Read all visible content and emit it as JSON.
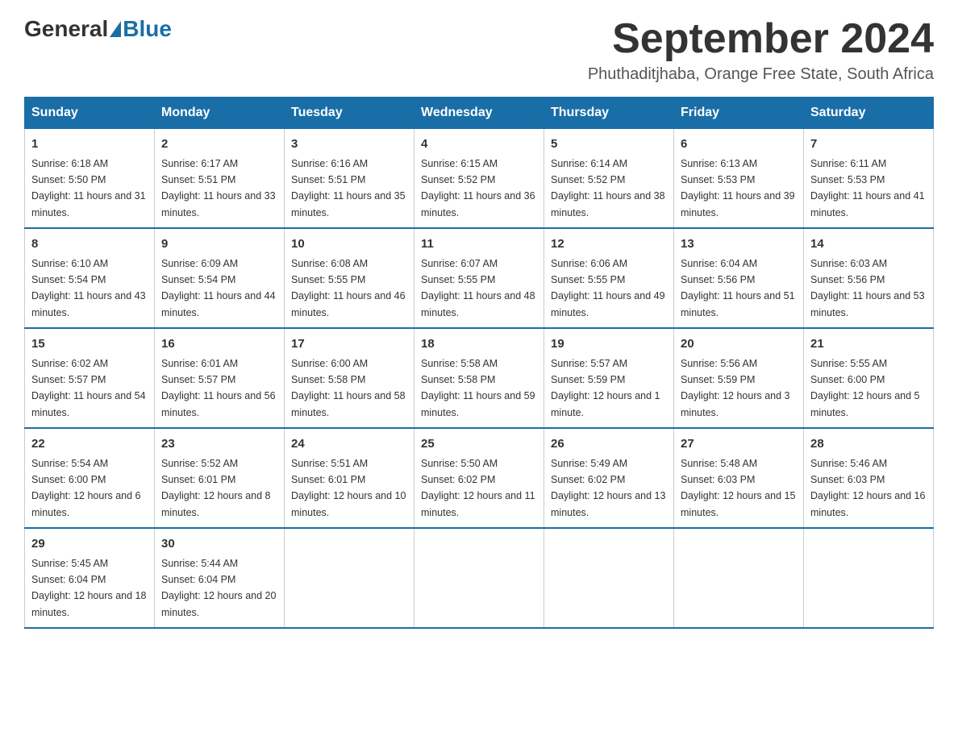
{
  "logo": {
    "general": "General",
    "blue": "Blue"
  },
  "title": "September 2024",
  "subtitle": "Phuthaditjhaba, Orange Free State, South Africa",
  "days_of_week": [
    "Sunday",
    "Monday",
    "Tuesday",
    "Wednesday",
    "Thursday",
    "Friday",
    "Saturday"
  ],
  "weeks": [
    [
      {
        "day": "1",
        "sunrise": "6:18 AM",
        "sunset": "5:50 PM",
        "daylight": "11 hours and 31 minutes."
      },
      {
        "day": "2",
        "sunrise": "6:17 AM",
        "sunset": "5:51 PM",
        "daylight": "11 hours and 33 minutes."
      },
      {
        "day": "3",
        "sunrise": "6:16 AM",
        "sunset": "5:51 PM",
        "daylight": "11 hours and 35 minutes."
      },
      {
        "day": "4",
        "sunrise": "6:15 AM",
        "sunset": "5:52 PM",
        "daylight": "11 hours and 36 minutes."
      },
      {
        "day": "5",
        "sunrise": "6:14 AM",
        "sunset": "5:52 PM",
        "daylight": "11 hours and 38 minutes."
      },
      {
        "day": "6",
        "sunrise": "6:13 AM",
        "sunset": "5:53 PM",
        "daylight": "11 hours and 39 minutes."
      },
      {
        "day": "7",
        "sunrise": "6:11 AM",
        "sunset": "5:53 PM",
        "daylight": "11 hours and 41 minutes."
      }
    ],
    [
      {
        "day": "8",
        "sunrise": "6:10 AM",
        "sunset": "5:54 PM",
        "daylight": "11 hours and 43 minutes."
      },
      {
        "day": "9",
        "sunrise": "6:09 AM",
        "sunset": "5:54 PM",
        "daylight": "11 hours and 44 minutes."
      },
      {
        "day": "10",
        "sunrise": "6:08 AM",
        "sunset": "5:55 PM",
        "daylight": "11 hours and 46 minutes."
      },
      {
        "day": "11",
        "sunrise": "6:07 AM",
        "sunset": "5:55 PM",
        "daylight": "11 hours and 48 minutes."
      },
      {
        "day": "12",
        "sunrise": "6:06 AM",
        "sunset": "5:55 PM",
        "daylight": "11 hours and 49 minutes."
      },
      {
        "day": "13",
        "sunrise": "6:04 AM",
        "sunset": "5:56 PM",
        "daylight": "11 hours and 51 minutes."
      },
      {
        "day": "14",
        "sunrise": "6:03 AM",
        "sunset": "5:56 PM",
        "daylight": "11 hours and 53 minutes."
      }
    ],
    [
      {
        "day": "15",
        "sunrise": "6:02 AM",
        "sunset": "5:57 PM",
        "daylight": "11 hours and 54 minutes."
      },
      {
        "day": "16",
        "sunrise": "6:01 AM",
        "sunset": "5:57 PM",
        "daylight": "11 hours and 56 minutes."
      },
      {
        "day": "17",
        "sunrise": "6:00 AM",
        "sunset": "5:58 PM",
        "daylight": "11 hours and 58 minutes."
      },
      {
        "day": "18",
        "sunrise": "5:58 AM",
        "sunset": "5:58 PM",
        "daylight": "11 hours and 59 minutes."
      },
      {
        "day": "19",
        "sunrise": "5:57 AM",
        "sunset": "5:59 PM",
        "daylight": "12 hours and 1 minute."
      },
      {
        "day": "20",
        "sunrise": "5:56 AM",
        "sunset": "5:59 PM",
        "daylight": "12 hours and 3 minutes."
      },
      {
        "day": "21",
        "sunrise": "5:55 AM",
        "sunset": "6:00 PM",
        "daylight": "12 hours and 5 minutes."
      }
    ],
    [
      {
        "day": "22",
        "sunrise": "5:54 AM",
        "sunset": "6:00 PM",
        "daylight": "12 hours and 6 minutes."
      },
      {
        "day": "23",
        "sunrise": "5:52 AM",
        "sunset": "6:01 PM",
        "daylight": "12 hours and 8 minutes."
      },
      {
        "day": "24",
        "sunrise": "5:51 AM",
        "sunset": "6:01 PM",
        "daylight": "12 hours and 10 minutes."
      },
      {
        "day": "25",
        "sunrise": "5:50 AM",
        "sunset": "6:02 PM",
        "daylight": "12 hours and 11 minutes."
      },
      {
        "day": "26",
        "sunrise": "5:49 AM",
        "sunset": "6:02 PM",
        "daylight": "12 hours and 13 minutes."
      },
      {
        "day": "27",
        "sunrise": "5:48 AM",
        "sunset": "6:03 PM",
        "daylight": "12 hours and 15 minutes."
      },
      {
        "day": "28",
        "sunrise": "5:46 AM",
        "sunset": "6:03 PM",
        "daylight": "12 hours and 16 minutes."
      }
    ],
    [
      {
        "day": "29",
        "sunrise": "5:45 AM",
        "sunset": "6:04 PM",
        "daylight": "12 hours and 18 minutes."
      },
      {
        "day": "30",
        "sunrise": "5:44 AM",
        "sunset": "6:04 PM",
        "daylight": "12 hours and 20 minutes."
      },
      null,
      null,
      null,
      null,
      null
    ]
  ]
}
